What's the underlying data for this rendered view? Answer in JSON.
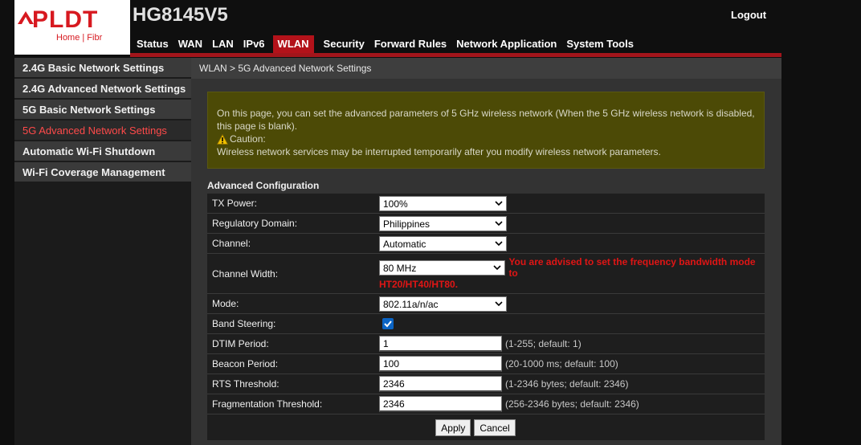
{
  "header": {
    "brand": "PLDT",
    "brand_sub": "Home | Fibr",
    "model": "HG8145V5",
    "logout_label": "Logout",
    "nav": [
      "Status",
      "WAN",
      "LAN",
      "IPv6",
      "WLAN",
      "Security",
      "Forward Rules",
      "Network Application",
      "System Tools"
    ],
    "nav_active": "WLAN"
  },
  "sidebar": {
    "items": [
      "2.4G Basic Network Settings",
      "2.4G Advanced Network Settings",
      "5G Basic Network Settings",
      "5G Advanced Network Settings",
      "Automatic Wi-Fi Shutdown",
      "Wi-Fi Coverage Management"
    ],
    "active": "5G Advanced Network Settings"
  },
  "main": {
    "breadcrumb": "WLAN > 5G Advanced Network Settings",
    "notice": {
      "text": "On this page, you can set the advanced parameters of 5 GHz wireless network (When the 5 GHz wireless network is disabled, this page is blank).",
      "caution_label": "Caution:",
      "caution_text": "Wireless network services may be interrupted temporarily after you modify wireless network parameters."
    },
    "config_title": "Advanced Configuration",
    "fields": {
      "tx_power": {
        "label": "TX Power:",
        "value": "100%"
      },
      "regulatory_domain": {
        "label": "Regulatory Domain:",
        "value": "Philippines"
      },
      "channel": {
        "label": "Channel:",
        "value": "Automatic"
      },
      "channel_width": {
        "label": "Channel Width:",
        "value": "80 MHz",
        "warning_line1": "You are advised to set the frequency bandwidth mode to",
        "warning_line2": "HT20/HT40/HT80."
      },
      "mode": {
        "label": "Mode:",
        "value": "802.11a/n/ac"
      },
      "band_steering": {
        "label": "Band Steering:",
        "checked": true
      },
      "dtim_period": {
        "label": "DTIM Period:",
        "value": "1",
        "hint": "(1-255; default: 1)"
      },
      "beacon_period": {
        "label": "Beacon Period:",
        "value": "100",
        "hint": "(20-1000 ms; default: 100)"
      },
      "rts_threshold": {
        "label": "RTS Threshold:",
        "value": "2346",
        "hint": "(1-2346 bytes; default: 2346)"
      },
      "frag_threshold": {
        "label": "Fragmentation Threshold:",
        "value": "2346",
        "hint": "(256-2346 bytes; default: 2346)"
      }
    },
    "apply_label": "Apply",
    "cancel_label": "Cancel"
  },
  "colors": {
    "brand_red": "#d71920",
    "nav_active_bg": "#b3121a",
    "sidebar_active_text": "#ff4a4a",
    "notice_bg": "#4c4a06",
    "warning_red": "#e01515",
    "checkbox_blue": "#0b64c4"
  }
}
